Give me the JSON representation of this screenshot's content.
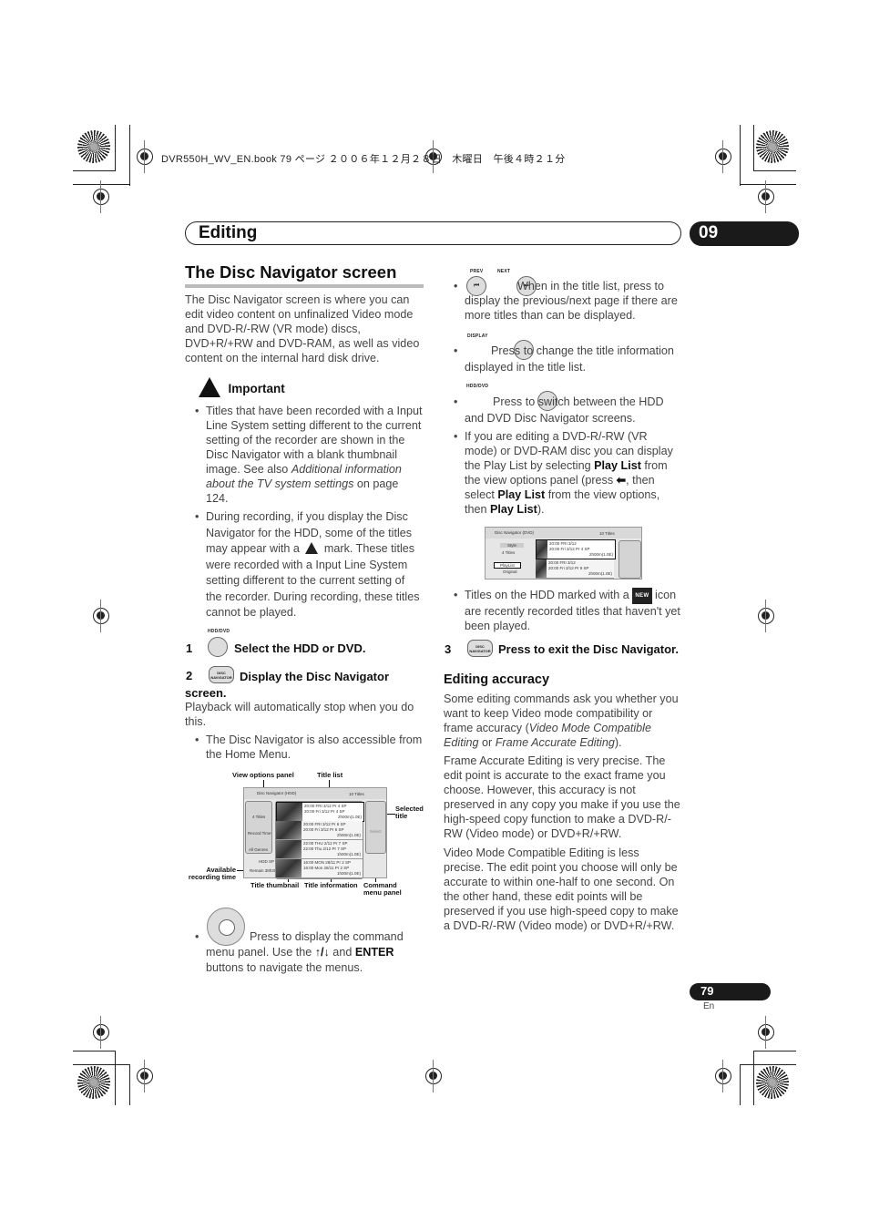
{
  "print_header": {
    "text": "DVR550H_WV_EN.book  79 ページ  ２００６年１２月２８日　木曜日　午後４時２１分"
  },
  "chapter": {
    "title": "Editing",
    "number": "09"
  },
  "section": {
    "title": "The Disc Navigator screen",
    "intro": "The Disc Navigator screen is where you can edit video content on unfinalized Video mode and DVD-R/-RW (VR mode) discs, DVD+R/+RW and DVD-RAM, as well as video content on the internal hard disk drive."
  },
  "important": {
    "heading": "Important",
    "bullets": [
      {
        "text_before": "Titles that have been recorded with a Input Line System setting different to the current setting of the recorder are shown in the Disc Navigator with a blank thumbnail image. See also ",
        "italic": "Additional information about the TV system settings",
        "text_after": " on page 124."
      },
      {
        "text_before": "During recording, if you display the Disc Navigator for the HDD, some of the titles may appear with a ",
        "icon": "warning-triangle-icon",
        "text_after": " mark. These titles were recorded with a Input Line System setting different to the current setting of the recorder. During recording, these titles cannot be played."
      }
    ]
  },
  "steps": [
    {
      "number": "1",
      "button_label": "HDD/DVD",
      "text": "Select the HDD or DVD."
    },
    {
      "number": "2",
      "button_label": "DISC NAVIGATOR",
      "text": "Display the Disc Navigator screen.",
      "body": "Playback will automatically stop when you do this.",
      "bullet": "The Disc Navigator is also accessible from the Home Menu."
    },
    {
      "number": "3",
      "button_label": "DISC NAVIGATOR",
      "text": "Press to exit the Disc Navigator."
    }
  ],
  "diagram": {
    "callouts": {
      "view_options": "View options panel",
      "title_list": "Title list",
      "selected_title": "Selected title",
      "available_time": "Available recording time",
      "title_thumbnail": "Title thumbnail",
      "title_information": "Title information",
      "command_menu": "Command menu panel"
    },
    "screen": {
      "header": "Disc Navigator (HDD)",
      "count": "10 Titles",
      "view_options": [
        "4 Titles",
        "Record Time",
        "All Genres"
      ],
      "available": "HDD SP",
      "remain": "Remain 38h30m",
      "command": "Select",
      "titles": [
        {
          "line1": "20:00  FRI  3/12  Pr 4  SP",
          "line2": "20:00   Fri  3/12  Pr 4  SP",
          "size": "2h00m(1.0E)"
        },
        {
          "line1": "20:00  FRI  3/12  Pr 6  SP",
          "line2": "20:00   Fri  3/12  Pr 6  SP",
          "size": "2h00m(1.0E)"
        },
        {
          "line1": "22:00  THU  2/12  Pr 7  SP",
          "line2": "22:00   Thu  2/12  Pr 7  SP",
          "size": "1h00m(1.0E)"
        },
        {
          "line1": "16:00  MON  28/11  Pr 2  SP",
          "line2": "16:00   Mon  28/11  Pr 2  SP",
          "size": "1h00m(1.0E)"
        }
      ]
    }
  },
  "dpad_bullet": {
    "before": "Press to display the command menu panel. Use the ",
    "arrows": "↑/↓",
    "and": " and ",
    "enter": "ENTER",
    "after": " buttons to navigate the menus."
  },
  "right_bullets": {
    "prev_next": {
      "prev_label": "PREV",
      "next_label": "NEXT",
      "text": "When in the title list, press to display the previous/next page if there are more titles than can be displayed."
    },
    "display": {
      "label": "DISPLAY",
      "text": "Press to change the title information displayed in the title list."
    },
    "hdd_dvd": {
      "label": "HDD/DVD",
      "text": "Press to switch between the HDD and DVD Disc Navigator screens."
    },
    "playlist": {
      "t1": "If you are editing a DVD-R/-RW (VR mode) or DVD-RAM disc you can display the Play List by selecting ",
      "b1": "Play List",
      "t2": " from the view options panel (press ",
      "arrow": "⬅",
      "t3": ", then select ",
      "b2": "Play List",
      "t4": " from the view options, then ",
      "b3": "Play List",
      "t5": ")."
    },
    "new_titles": {
      "before": "Titles on the HDD marked with a ",
      "badge": "NEW",
      "after": " icon are recently recorded titles that haven't yet been played."
    }
  },
  "dvd_screen": {
    "header": "Disc Navigator (DVD)",
    "count": "10 Titles",
    "style": "Style",
    "titles_opt": "4 Titles",
    "playlist": "PlayList",
    "original": "Original",
    "rows": [
      {
        "line1": "20:00  FRI  3/12",
        "line2": "20:00   Fri  3/12  Pr 4  SP",
        "size": "2h00m(1.0E)"
      },
      {
        "line1": "20:00  FRI  3/12",
        "line2": "20:00   Fri  3/12  Pr 9  SP",
        "size": "2h00m(1.0E)"
      }
    ]
  },
  "editing_accuracy": {
    "title": "Editing accuracy",
    "p1_before": "Some editing commands ask you whether you want to keep Video mode compatibility or frame accuracy (",
    "p1_i1": "Video Mode Compatible Editing",
    "p1_or": " or ",
    "p1_i2": "Frame Accurate Editing",
    "p1_after": ").",
    "p2": "Frame Accurate Editing is very precise. The edit point is accurate to the exact frame you choose. However, this accuracy is not preserved in any copy you make if you use the high-speed copy function to make a DVD-R/-RW (Video mode) or DVD+R/+RW.",
    "p3": "Video Mode Compatible Editing is less precise. The edit point you choose will only be accurate to within one-half to one second. On the other hand, these edit points will be preserved if you use high-speed copy to make a DVD-R/-RW (Video mode) or DVD+R/+RW."
  },
  "footer": {
    "page": "79",
    "lang": "En"
  }
}
